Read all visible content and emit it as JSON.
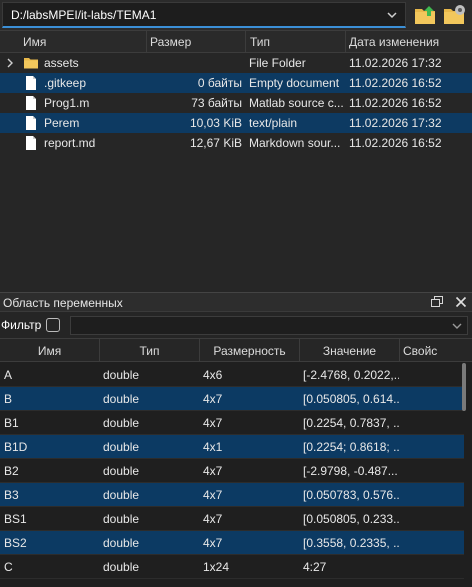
{
  "path_bar": {
    "path": "D:/labsMPEI/it-labs/TEMA1"
  },
  "file_browser": {
    "columns": [
      "Имя",
      "Размер",
      "Тип",
      "Дата изменения"
    ],
    "rows": [
      {
        "name": "assets",
        "size": "",
        "type": "File Folder",
        "date": "11.02.2026 17:32",
        "icon": "folder-icon",
        "selected": false,
        "has_expander": true
      },
      {
        "name": ".gitkeep",
        "size": "0 байты",
        "type": "Empty document",
        "date": "11.02.2026 16:52",
        "icon": "file-icon",
        "selected": true,
        "has_expander": false
      },
      {
        "name": "Prog1.m",
        "size": "73 байты",
        "type": "Matlab source c...",
        "date": "11.02.2026 16:52",
        "icon": "file-icon",
        "selected": false,
        "has_expander": false
      },
      {
        "name": "Perem",
        "size": "10,03 KiB",
        "type": "text/plain",
        "date": "11.02.2026 17:32",
        "icon": "file-icon",
        "selected": true,
        "has_expander": false
      },
      {
        "name": "report.md",
        "size": "12,67 KiB",
        "type": "Markdown sour...",
        "date": "11.02.2026 16:52",
        "icon": "file-icon",
        "selected": false,
        "has_expander": false
      }
    ]
  },
  "variables_panel": {
    "title": "Область переменных",
    "filter_label": "Фильтр",
    "filter_value": "",
    "columns": [
      "Имя",
      "Тип",
      "Размерность",
      "Значение",
      "Свойс"
    ],
    "rows": [
      {
        "name": "A",
        "type": "double",
        "dims": "4x6",
        "value": "[-2.4768, 0.2022,...",
        "selected": false
      },
      {
        "name": "B",
        "type": "double",
        "dims": "4x7",
        "value": "[0.050805, 0.614...",
        "selected": true
      },
      {
        "name": "B1",
        "type": "double",
        "dims": "4x7",
        "value": "[0.2254, 0.7837, ...",
        "selected": false
      },
      {
        "name": "B1D",
        "type": "double",
        "dims": "4x1",
        "value": "[0.2254; 0.8618; ...",
        "selected": true
      },
      {
        "name": "B2",
        "type": "double",
        "dims": "4x7",
        "value": "[-2.9798, -0.487...",
        "selected": false
      },
      {
        "name": "B3",
        "type": "double",
        "dims": "4x7",
        "value": "[0.050783, 0.576...",
        "selected": true
      },
      {
        "name": "BS1",
        "type": "double",
        "dims": "4x7",
        "value": "[0.050805, 0.233...",
        "selected": false
      },
      {
        "name": "BS2",
        "type": "double",
        "dims": "4x7",
        "value": "[0.3558, 0.2335, ...",
        "selected": true
      },
      {
        "name": "C",
        "type": "double",
        "dims": "1x24",
        "value": "4:27",
        "selected": false
      }
    ]
  },
  "colors": {
    "accent": "#3b8fd6",
    "selection": "#0d3a62",
    "folder": "#e8b84a"
  }
}
